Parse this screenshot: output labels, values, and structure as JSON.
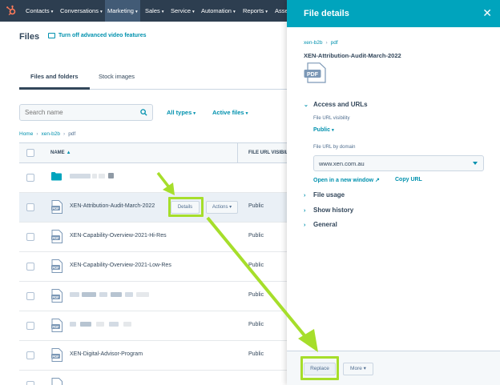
{
  "nav": {
    "items": [
      "Contacts",
      "Conversations",
      "Marketing",
      "Sales",
      "Service",
      "Automation",
      "Reports",
      "Asse"
    ],
    "active": "Marketing"
  },
  "page": {
    "title": "Files",
    "video_link": "Turn off advanced video features",
    "tabs": [
      "Files and folders",
      "Stock images"
    ]
  },
  "toolbar": {
    "search_placeholder": "Search name",
    "filter_types": "All types",
    "filter_status": "Active files"
  },
  "breadcrumb": [
    "Home",
    "xen-b2b",
    "pdf"
  ],
  "table": {
    "columns": [
      "NAME",
      "FILE URL VISIBILI"
    ],
    "rows": [
      {
        "name": "",
        "visibility": "",
        "type": "folder"
      },
      {
        "name": "XEN-Attribution-Audit-March-2022",
        "visibility": "Public",
        "type": "pdf"
      },
      {
        "name": "XEN-Capability-Overview-2021-Hi-Res",
        "visibility": "Public",
        "type": "pdf"
      },
      {
        "name": "XEN-Capability-Overview-2021-Low-Res",
        "visibility": "Public",
        "type": "pdf"
      },
      {
        "name": "",
        "visibility": "Public",
        "type": "pdf"
      },
      {
        "name": "",
        "visibility": "Public",
        "type": "pdf"
      },
      {
        "name": "XEN-Digital-Advisor-Program",
        "visibility": "Public",
        "type": "pdf"
      }
    ],
    "row_details_label": "Details",
    "row_actions_label": "Actions"
  },
  "panel": {
    "title": "File details",
    "breadcrumb": [
      "xen-b2b",
      "pdf"
    ],
    "file_name": "XEN-Attribution-Audit-March-2022",
    "file_icon_text": "PDF",
    "sections": {
      "access": "Access and URLs",
      "usage": "File usage",
      "history": "Show history",
      "general": "General"
    },
    "visibility_label": "File URL visibility",
    "visibility_value": "Public",
    "domain_label": "File URL by domain",
    "domain_value": "www.xen.com.au",
    "open_link": "Open in a new window",
    "copy_link": "Copy URL",
    "replace_label": "Replace",
    "more_label": "More"
  },
  "colors": {
    "nav_bg": "#2d3e50",
    "panel_header": "#00a4bd",
    "link": "#0091ae",
    "highlight": "#a6de2b",
    "hubspot_orange": "#ff7a59"
  }
}
